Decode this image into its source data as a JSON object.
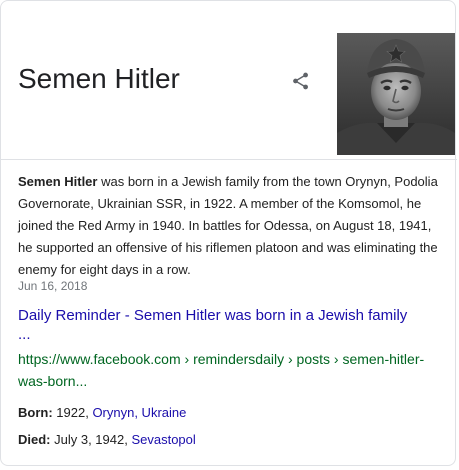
{
  "entity": {
    "name": "Semen Hitler"
  },
  "photo": {
    "alt": "Semen Hitler"
  },
  "icons": {
    "share": "share-icon"
  },
  "description": {
    "subject": "Semen Hitler",
    "text": " was born in a Jewish family from the town Orynyn, Podolia Governorate, Ukrainian SSR, in 1922. A member of the Komsomol, he joined the Red Army in 1940. In battles for Odessa, on August 18, 1941, he supported an offensive of his riflemen platoon and was eliminating the enemy for eight days in a row.",
    "date": "Jun 16, 2018"
  },
  "source": {
    "title": "Daily Reminder - Semen Hitler was born in a Jewish family",
    "ellipsis": "...",
    "url": "https://www.facebook.com › remindersdaily › posts › semen-hitler-was-born..."
  },
  "facts": {
    "born": {
      "label": "Born:",
      "year": " 1922, ",
      "place": "Orynyn, Ukraine"
    },
    "died": {
      "label": "Died:",
      "date": " July 3, 1942, ",
      "place": "Sevastopol"
    }
  },
  "colors": {
    "link": "#1a0dab",
    "url": "#006621",
    "muted": "#70757a",
    "border": "#dfe1e5"
  }
}
